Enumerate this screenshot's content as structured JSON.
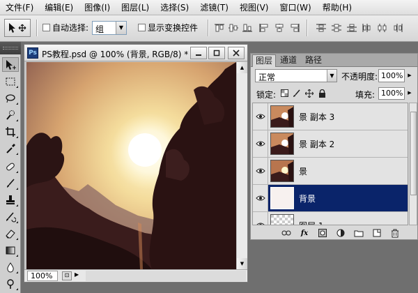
{
  "menubar": {
    "items": [
      "文件(F)",
      "编辑(E)",
      "图像(I)",
      "图层(L)",
      "选择(S)",
      "滤镜(T)",
      "视图(V)",
      "窗口(W)",
      "帮助(H)"
    ]
  },
  "options": {
    "tool_preset_icon": "move-tool-icon",
    "auto_select_label": "自动选择:",
    "auto_select_value": "组",
    "show_transform_label": "显示变换控件"
  },
  "document": {
    "badge": "Ps",
    "title": "PS教程.psd @ 100% (背景, RGB/8) *",
    "zoom": "100%",
    "image_description_colors": {
      "sky_top": "#e9c48d",
      "sun": "#ffffff",
      "trees": "#2a1212"
    }
  },
  "layers_panel": {
    "tabs": [
      "图层",
      "通道",
      "路径"
    ],
    "blend_mode": "正常",
    "opacity_label": "不透明度:",
    "opacity_value": "100%",
    "lock_label": "锁定:",
    "fill_label": "填充:",
    "fill_value": "100%",
    "layers": [
      {
        "name": "景 副本 3",
        "visible": true,
        "selected": false,
        "thumb": "sunset"
      },
      {
        "name": "景 副本 2",
        "visible": true,
        "selected": false,
        "thumb": "sunset"
      },
      {
        "name": "景",
        "visible": true,
        "selected": false,
        "thumb": "sunset"
      },
      {
        "name": "背景",
        "visible": true,
        "selected": true,
        "thumb": "blank"
      },
      {
        "name": "图层 1",
        "visible": true,
        "selected": false,
        "thumb": "transparent"
      }
    ]
  },
  "colors": {
    "selection": "#0a246a",
    "ps_blue": "#1c3d7a"
  }
}
